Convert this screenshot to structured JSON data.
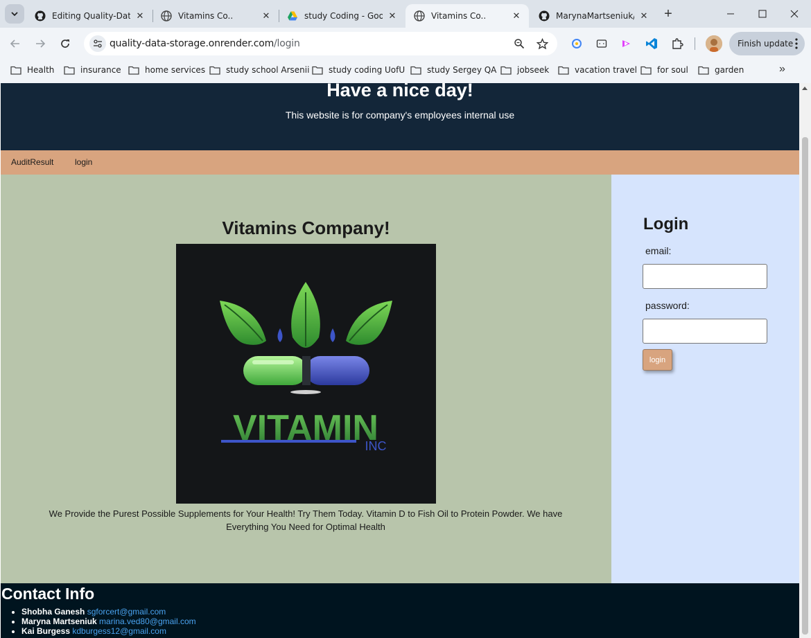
{
  "browser": {
    "tabs": [
      {
        "title": "Editing Quality-Data",
        "icon": "github-icon",
        "active": false
      },
      {
        "title": "Vitamins Co..",
        "icon": "globe-icon",
        "active": false
      },
      {
        "title": "study Coding - Goog",
        "icon": "google-drive-icon",
        "active": false
      },
      {
        "title": "Vitamins Co..",
        "icon": "globe-icon",
        "active": true
      },
      {
        "title": "MarynaMartseniuk/C",
        "icon": "github-icon",
        "active": false
      }
    ],
    "url_domain": "quality-data-storage.onrender.com",
    "url_path": "/login",
    "finish_update_label": "Finish update",
    "bookmarks": [
      "Health",
      "insurance",
      "home services",
      "study school Arsenii",
      "study coding UofU",
      "study Sergey QA",
      "jobseek",
      "vacation travel",
      "for soul",
      "garden"
    ]
  },
  "header": {
    "title": "Have a nice day!",
    "subtitle": "This website is for company's employees internal use"
  },
  "nav": {
    "items": [
      "AuditResult",
      "login"
    ]
  },
  "main": {
    "heading": "Vitamins Company!",
    "logo_text": "VITAMIN",
    "logo_subtext": "INC",
    "description": "We Provide the Purest Possible Supplements for Your Health! Try Them Today. Vitamin D to Fish Oil to Protein Powder. We have Everything You Need for Optimal Health"
  },
  "login": {
    "heading": "Login",
    "email_label": "email:",
    "password_label": "password:",
    "email_value": "",
    "password_value": "",
    "button_label": "login"
  },
  "footer": {
    "heading": "Contact Info",
    "contacts": [
      {
        "name": "Shobha Ganesh",
        "email": "sgforcert@gmail.com"
      },
      {
        "name": "Maryna Martseniuk",
        "email": "marina.ved80@gmail.com"
      },
      {
        "name": "Kai Burgess",
        "email": "kdburgess12@gmail.com"
      }
    ]
  },
  "colors": {
    "header_bg": "#132639",
    "nav_bg": "#d8a47f",
    "main_bg": "#b8c5ab",
    "side_bg": "#d6e4fd",
    "footer_bg": "#00141f",
    "link": "#4aa3f0"
  }
}
